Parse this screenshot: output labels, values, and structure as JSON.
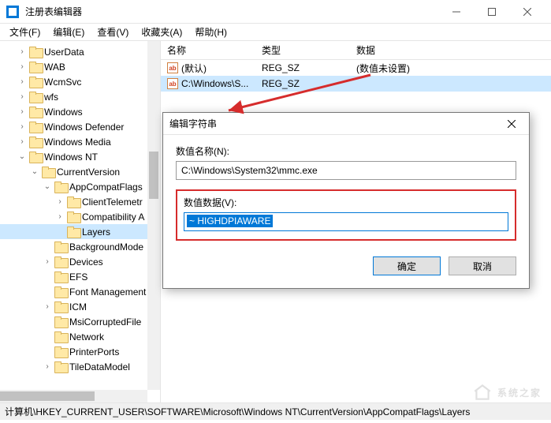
{
  "window": {
    "title": "注册表编辑器"
  },
  "menu": {
    "file": "文件(F)",
    "edit": "编辑(E)",
    "view": "查看(V)",
    "favorites": "收藏夹(A)",
    "help": "帮助(H)"
  },
  "tree": [
    {
      "depth": 1,
      "expand": ">",
      "label": "UserData"
    },
    {
      "depth": 1,
      "expand": ">",
      "label": "WAB"
    },
    {
      "depth": 1,
      "expand": ">",
      "label": "WcmSvc"
    },
    {
      "depth": 1,
      "expand": ">",
      "label": "wfs"
    },
    {
      "depth": 1,
      "expand": ">",
      "label": "Windows"
    },
    {
      "depth": 1,
      "expand": ">",
      "label": "Windows Defender"
    },
    {
      "depth": 1,
      "expand": ">",
      "label": "Windows Media"
    },
    {
      "depth": 1,
      "expand": "v",
      "label": "Windows NT"
    },
    {
      "depth": 2,
      "expand": "v",
      "label": "CurrentVersion"
    },
    {
      "depth": 3,
      "expand": "v",
      "label": "AppCompatFlags"
    },
    {
      "depth": 4,
      "expand": ">",
      "label": "ClientTelemetr"
    },
    {
      "depth": 4,
      "expand": ">",
      "label": "Compatibility A"
    },
    {
      "depth": 4,
      "expand": "",
      "label": "Layers",
      "selected": true
    },
    {
      "depth": 3,
      "expand": "",
      "label": "BackgroundMode"
    },
    {
      "depth": 3,
      "expand": ">",
      "label": "Devices"
    },
    {
      "depth": 3,
      "expand": "",
      "label": "EFS"
    },
    {
      "depth": 3,
      "expand": "",
      "label": "Font Management"
    },
    {
      "depth": 3,
      "expand": ">",
      "label": "ICM"
    },
    {
      "depth": 3,
      "expand": "",
      "label": "MsiCorruptedFile"
    },
    {
      "depth": 3,
      "expand": "",
      "label": "Network"
    },
    {
      "depth": 3,
      "expand": "",
      "label": "PrinterPorts"
    },
    {
      "depth": 3,
      "expand": ">",
      "label": "TileDataModel"
    }
  ],
  "list": {
    "columns": {
      "name": "名称",
      "type": "类型",
      "data": "数据"
    },
    "rows": [
      {
        "name": "(默认)",
        "type": "REG_SZ",
        "data": "(数值未设置)",
        "selected": false
      },
      {
        "name": "C:\\Windows\\S...",
        "type": "REG_SZ",
        "data": "",
        "selected": true
      }
    ]
  },
  "dialog": {
    "title": "编辑字符串",
    "name_label": "数值名称(N):",
    "name_value": "C:\\Windows\\System32\\mmc.exe",
    "data_label": "数值数据(V):",
    "data_value": "~ HIGHDPIAWARE",
    "ok": "确定",
    "cancel": "取消"
  },
  "statusbar": "计算机\\HKEY_CURRENT_USER\\SOFTWARE\\Microsoft\\Windows NT\\CurrentVersion\\AppCompatFlags\\Layers",
  "watermark": "系统之家"
}
